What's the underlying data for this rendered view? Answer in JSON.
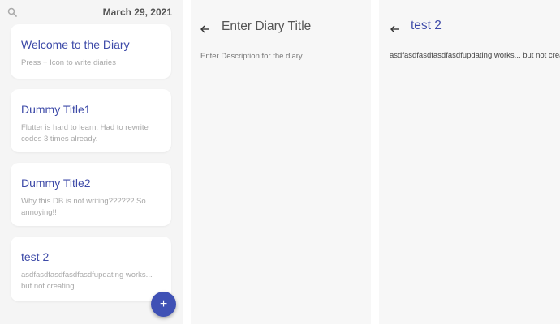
{
  "list_panel": {
    "date": "March 29, 2021",
    "entries": [
      {
        "title": "Welcome to the Diary",
        "description": "Press + Icon to write diaries"
      },
      {
        "title": "Dummy Title1",
        "description": "Flutter is hard to learn. Had to rewrite codes 3 times already."
      },
      {
        "title": "Dummy Title2",
        "description": "Why this DB is not writing?????? So annoying!!"
      },
      {
        "title": "test 2",
        "description": "asdfasdfasdfasdfasdfupdating works... but not creating..."
      }
    ],
    "fab_label": "+",
    "icons": {
      "search": "search-icon",
      "add": "plus-icon"
    }
  },
  "new_panel": {
    "title_placeholder": "Enter Diary Title",
    "description_placeholder": "Enter Description for the diary",
    "icons": {
      "back": "arrow-back-icon"
    }
  },
  "detail_panel": {
    "title": "test 2",
    "body": "asdfasdfasdfasdfasdfupdating works... but not creating...",
    "icons": {
      "back": "arrow-back-icon"
    }
  },
  "colors": {
    "accent": "#3f51b5",
    "title_blue": "#3d4aa8",
    "panel_bg": "#f5f5f5",
    "card_bg": "#ffffff"
  }
}
